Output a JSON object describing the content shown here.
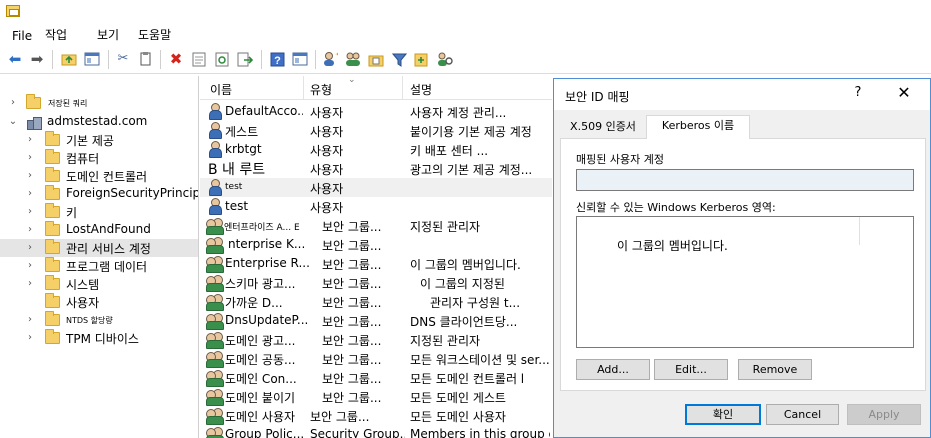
{
  "menu": {
    "file": "File",
    "action": "작업",
    "view": "보기",
    "help": "도움말"
  },
  "toolbar_icons": [
    "back-arrow-icon",
    "forward-arrow-icon",
    "up-folder-icon",
    "show-hide-tree-icon",
    "cut-icon",
    "copy-icon",
    "delete-icon",
    "properties-icon",
    "refresh-icon",
    "export-list-icon",
    "help-icon",
    "console-icon",
    "new-user-icon",
    "new-group-icon",
    "new-ou-icon",
    "filter-icon",
    "add-to-group-icon",
    "find-icon"
  ],
  "tree": {
    "saved_queries": "저장된 쿼리",
    "domain": "admstestad.com",
    "items": [
      "기본 제공",
      "컴퓨터",
      "도메인 컨트롤러",
      "ForeignSecurityPrincipals",
      "키",
      "LostAndFound",
      "관리 서비스 계정",
      "프로그램 데이터",
      "시스템",
      "사용자",
      "NTDS 할당량",
      "TPM 디바이스"
    ]
  },
  "list": {
    "columns": [
      "이름",
      "유형",
      "설명"
    ],
    "rows": [
      {
        "icon": "user-icon",
        "name": "DefaultAcco...",
        "type": "사용자",
        "desc": "사용자 계정 관리..."
      },
      {
        "icon": "user-icon",
        "name": "게스트",
        "type": "사용자",
        "desc": "붙이기용 기본 제공 계정"
      },
      {
        "icon": "user-icon",
        "name": "krbtgt",
        "type": "사용자",
        "desc": "키 배포 센터 ..."
      },
      {
        "icon": "",
        "name": "B 내 루트",
        "type": "사용자",
        "desc": "광고의 기본 제공 계정..."
      },
      {
        "icon": "user-icon",
        "name": "test",
        "type": "사용자",
        "desc": ""
      },
      {
        "icon": "user-icon",
        "name": "test",
        "type": "사용자",
        "desc": ""
      },
      {
        "icon": "group-icon",
        "name": "엔터프라이즈 A... E",
        "type": "보안 그룹...",
        "desc": "지정된 관리자"
      },
      {
        "icon": "group-icon",
        "name": "nterprise K...",
        "type": "보안 그룹...",
        "desc": ""
      },
      {
        "icon": "group-icon",
        "name": "Enterprise R...",
        "type": "보안 그룹...",
        "desc": "이 그룹의 멤버입니다."
      },
      {
        "icon": "group-icon",
        "name": "스키마 광고...",
        "type": "보안 그룹...",
        "desc": "이 그룹의 지정된"
      },
      {
        "icon": "group-icon",
        "name": "가까운 D...",
        "type": "보안 그룹...",
        "desc": "관리자 구성원 t..."
      },
      {
        "icon": "group-icon",
        "name": "DnsUpdateP...",
        "type": "보안 그룹...",
        "desc": "DNS 클라이언트당..."
      },
      {
        "icon": "group-icon",
        "name": "도메인 광고...",
        "type": "보안 그룹...",
        "desc": "지정된 관리자"
      },
      {
        "icon": "group-icon",
        "name": "도메인 공동...",
        "type": "보안 그룹...",
        "desc": "모든 워크스테이션 및 ser..."
      },
      {
        "icon": "group-icon",
        "name": "도메인 Con...",
        "type": "보안 그룹...",
        "desc": "모든 도메인 컨트롤러 l"
      },
      {
        "icon": "group-icon",
        "name": "도메인 붙이기",
        "type": "보안 그룹...",
        "desc": "모든 도메인 게스트"
      },
      {
        "icon": "group-icon",
        "name": "도메인 사용자",
        "type": "보안 그룹...",
        "desc": "모든 도메인 사용자"
      },
      {
        "icon": "group-icon",
        "name": "Group Polic...",
        "type": "Security Group...",
        "desc": "Members in this group c..."
      }
    ]
  },
  "dialog": {
    "title": "보안 ID 매핑",
    "help": "?",
    "close": "✕",
    "tabs": [
      "X.509 인증서",
      "Kerberos 이름"
    ],
    "mapped_account_label": "매핑된 사용자 계정",
    "mapped_account_value": "",
    "realms_label": "신뢰할 수 있는 Windows Kerberos 영역:",
    "realm_item": "이 그룹의 멤버입니다.",
    "add_button": "Add...",
    "edit_button": "Edit...",
    "remove_button": "Remove",
    "ok_button": "확인",
    "cancel_button": "Cancel",
    "apply_button": "Apply"
  }
}
